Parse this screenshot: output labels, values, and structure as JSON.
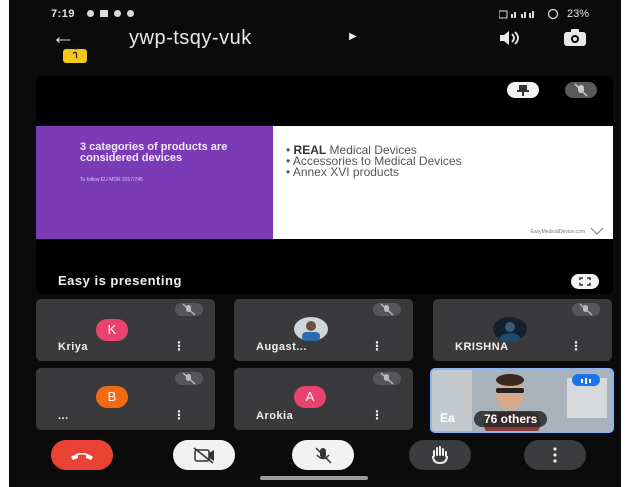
{
  "status_bar": {
    "time": "7:19",
    "right_text": "23%"
  },
  "meeting": {
    "title": "ywp-tsqy-vuk",
    "badge_text": "า้"
  },
  "presentation": {
    "slide_title": "3 categories of products are considered devices",
    "slide_subtitle": "To follow EU MDR 2017/745",
    "bullet_1_bold": "REAL",
    "bullet_1_rest": " Medical Devices",
    "bullet_2": "Accessories to Medical Devices",
    "bullet_3": "Annex XVI products",
    "slide_footer": "EasyMedicalDevice.com",
    "presenting_label": "Easy is presenting"
  },
  "participants": [
    {
      "name": "Kriya",
      "initial": "K",
      "color": "#e8436e"
    },
    {
      "name": "Augast...",
      "initial": "",
      "color": "#b9c2c8"
    },
    {
      "name": "KRISHNA",
      "initial": "",
      "color": "#1d2b3a"
    },
    {
      "name": "...",
      "initial": "B",
      "color": "#f26a12"
    },
    {
      "name": "Arokia",
      "initial": "A",
      "color": "#e8436e"
    }
  ],
  "self_tile": {
    "name_prefix": "Ea",
    "others_label": "76 others"
  },
  "colors": {
    "end_call": "#ea4335",
    "control_light": "#f2f2f2",
    "control_dark": "#3c3c3e",
    "slide_purple": "#7b3bb6"
  },
  "icons": {
    "back": "arrow-left-icon",
    "speaker": "speaker-icon",
    "switch_camera": "switch-camera-icon",
    "pin": "pin-icon",
    "mic_off": "mic-off-icon",
    "fullscreen": "fullscreen-icon",
    "end_call": "phone-hangup-icon",
    "camera_off": "camera-off-icon",
    "raise_hand": "raise-hand-icon",
    "more": "more-vert-icon"
  }
}
